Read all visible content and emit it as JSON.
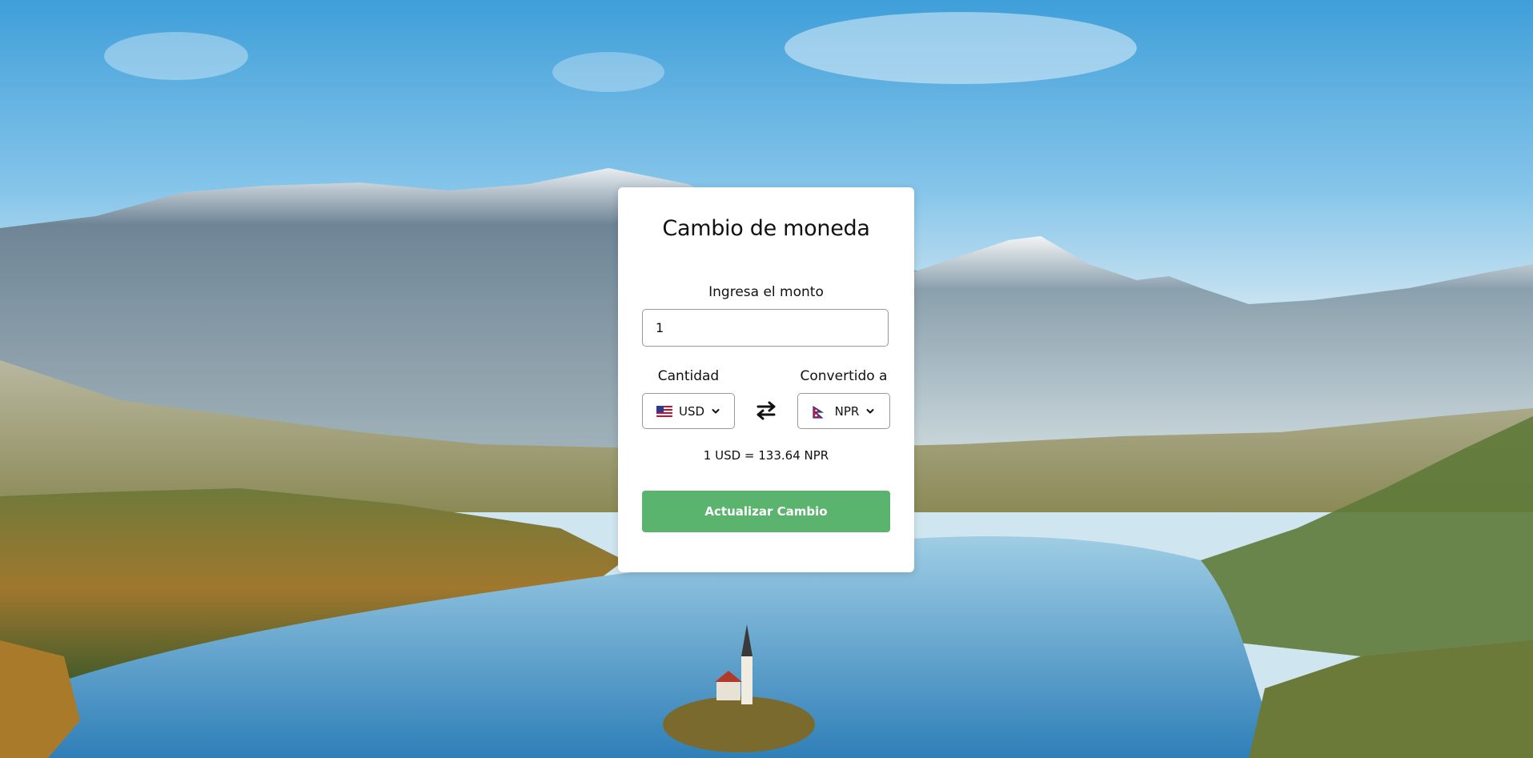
{
  "converter": {
    "title": "Cambio de moneda",
    "amount_label": "Ingresa el monto",
    "amount_value": "1",
    "from_label": "Cantidad",
    "to_label": "Convertido a",
    "from_currency": {
      "code": "USD",
      "flag": "us-flag-icon"
    },
    "to_currency": {
      "code": "NPR",
      "flag": "nepal-flag-icon"
    },
    "swap_icon": "swap-arrows-icon",
    "rate_text": "1 USD = 133.64 NPR",
    "button_label": "Actualizar Cambio"
  },
  "colors": {
    "button": "#5bb46d",
    "card": "#ffffff"
  }
}
